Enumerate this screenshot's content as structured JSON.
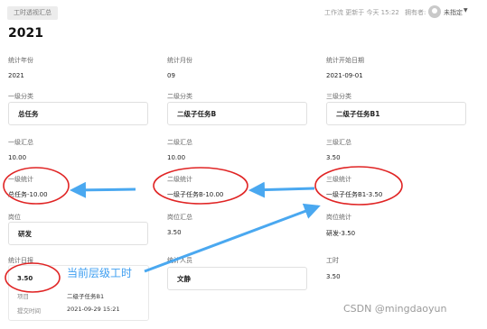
{
  "header": {
    "tag": "工时透视汇总",
    "updated": "工作流 更新于 今天 15:22",
    "owner_label": "拥有者:",
    "owner_value": "未指定"
  },
  "title": "2021",
  "fields": {
    "year": {
      "label": "统计年份",
      "value": "2021"
    },
    "month": {
      "label": "统计月份",
      "value": "09"
    },
    "start": {
      "label": "统计开始日期",
      "value": "2021-09-01"
    },
    "cat1": {
      "label": "一级分类",
      "value": "总任务"
    },
    "cat2": {
      "label": "二级分类",
      "value": "二级子任务B"
    },
    "cat3": {
      "label": "三级分类",
      "value": "二级子任务B1"
    },
    "sum1": {
      "label": "一级汇总",
      "value": "10.00"
    },
    "sum2": {
      "label": "二级汇总",
      "value": "10.00"
    },
    "sum3": {
      "label": "三级汇总",
      "value": "3.50"
    },
    "stat1": {
      "label": "一级统计",
      "value": "总任务-10.00"
    },
    "stat2": {
      "label": "二级统计",
      "value": "一级子任务B-10.00"
    },
    "stat3": {
      "label": "三级统计",
      "value": "一级子任务B1-3.50"
    },
    "post": {
      "label": "岗位",
      "value": "研发"
    },
    "postsum": {
      "label": "岗位汇总",
      "value": "3.50"
    },
    "poststat": {
      "label": "岗位统计",
      "value": "研发-3.50"
    },
    "daily": {
      "label": "统计日报",
      "value": "3.50"
    },
    "staff": {
      "label": "统计人员",
      "value": "文静"
    },
    "hours": {
      "label": "工时",
      "value": "3.50"
    }
  },
  "daily_card": {
    "project_label": "项目",
    "project_value": "二级子任务B1",
    "submit_label": "提交时间",
    "submit_value": "2021-09-29 15:21"
  },
  "annotation": "当前层级工时",
  "watermark": "CSDN @mingdaoyun",
  "colors": {
    "circle": "#e02424",
    "arrow": "#4aa8f0"
  }
}
